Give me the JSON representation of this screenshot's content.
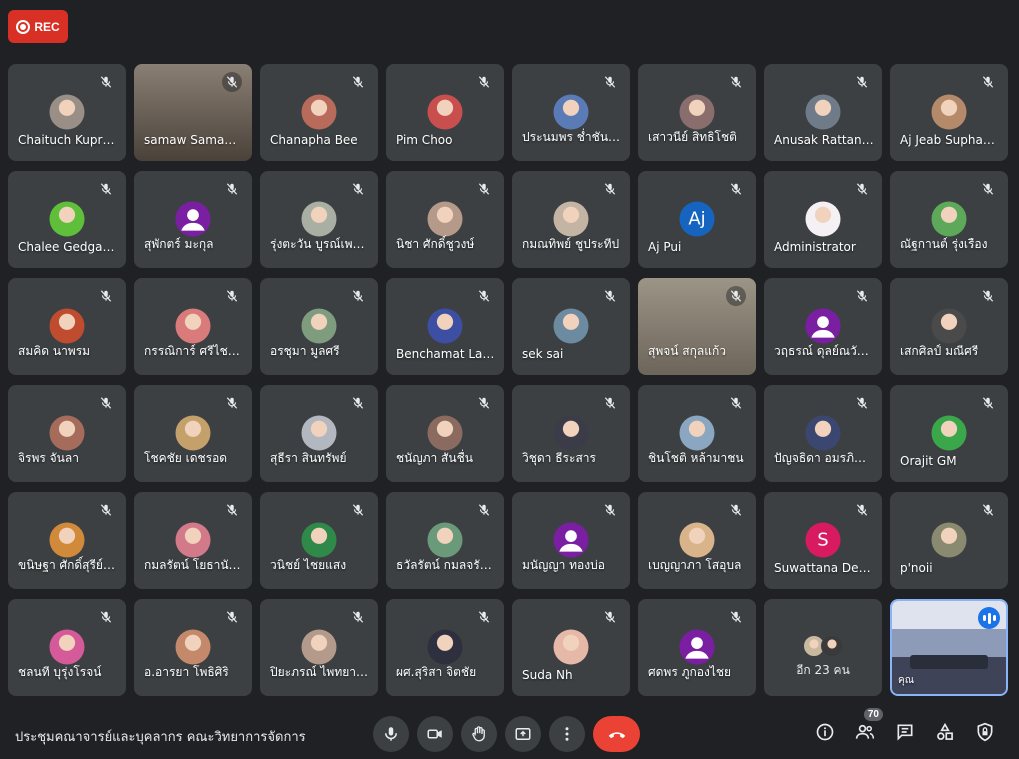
{
  "recording": {
    "label": "REC",
    "color": "#d93025"
  },
  "participants": [
    {
      "name": "Chaituch Kupra…",
      "type": "photo",
      "color": "#9a8f86"
    },
    {
      "name": "samaw Sama…",
      "type": "video"
    },
    {
      "name": "Chanapha Bee",
      "type": "photo",
      "color": "#b86b5a"
    },
    {
      "name": "Pim Choo",
      "type": "photo",
      "color": "#c94f4f"
    },
    {
      "name": "ประนมพร ช่ำชันม…",
      "type": "photo",
      "color": "#5a7bb5"
    },
    {
      "name": "เสาวนีย์ สิทธิโชติ",
      "type": "photo",
      "color": "#8a6d6d"
    },
    {
      "name": "Anusak Rattana…",
      "type": "photo",
      "color": "#6f7b89"
    },
    {
      "name": "Aj Jeab Suphan…",
      "type": "photo",
      "color": "#b58a6b"
    },
    {
      "name": "Chalee Gedgaew",
      "type": "photo",
      "color": "#5fbf3a"
    },
    {
      "name": "สุพักตร์ มะกุล",
      "type": "default"
    },
    {
      "name": "รุ่งตะวัน บูรณ์เพนา…",
      "type": "photo",
      "color": "#a9b0a3"
    },
    {
      "name": "นิชา ศักดิ์ชูวงษ์",
      "type": "photo",
      "color": "#b59a8a"
    },
    {
      "name": "กมณทิพย์ ชูประทีป",
      "type": "photo",
      "color": "#c3b4a4"
    },
    {
      "name": "Aj Pui",
      "type": "letter",
      "letter": "Aj",
      "color": "#1565c0"
    },
    {
      "name": "Administrator",
      "type": "photo",
      "color": "#f5f0f3"
    },
    {
      "name": "ณัฐกานต์ รุ่งเรือง",
      "type": "photo",
      "color": "#5ea85a"
    },
    {
      "name": "สมคิด นาพรม",
      "type": "photo",
      "color": "#c04c2f"
    },
    {
      "name": "กรรณิการ์ ศรีไชย…",
      "type": "photo",
      "color": "#d97b7b"
    },
    {
      "name": "อรชุมา มูลศรี",
      "type": "photo",
      "color": "#7f9c7f"
    },
    {
      "name": "Benchamat Lak…",
      "type": "photo",
      "color": "#3d4fa3"
    },
    {
      "name": "sek sai",
      "type": "photo",
      "color": "#6c8aa0"
    },
    {
      "name": "สุพจน์ สกุลแก้ว",
      "type": "video"
    },
    {
      "name": "วฤธรณ์ ดุลย์ณวัฒน์",
      "type": "default"
    },
    {
      "name": "เสกศิลป์ มณีศรี",
      "type": "photo",
      "color": "#4a4a4a"
    },
    {
      "name": "จิรพร จันลา",
      "type": "photo",
      "color": "#a56c5c"
    },
    {
      "name": "โชคชัย เดชรอด",
      "type": "photo",
      "color": "#c4a06a"
    },
    {
      "name": "สุธีรา สินทรัพย์",
      "type": "photo",
      "color": "#b3b8c0"
    },
    {
      "name": "ชนัญภา สันชื่น",
      "type": "photo",
      "color": "#8b6b5f"
    },
    {
      "name": "วิชุดา ธีระสาร",
      "type": "photo",
      "color": "#3c3c48"
    },
    {
      "name": "ชินโชติ หล้ามาชน",
      "type": "photo",
      "color": "#8aa6c0"
    },
    {
      "name": "ปัญจธิดา อมรภิญ…",
      "type": "photo",
      "color": "#3b4770"
    },
    {
      "name": "Orajit GM",
      "type": "photo",
      "color": "#3aa84a"
    },
    {
      "name": "ขนิษฐา ศักดิ์สุรีย์ม…",
      "type": "photo",
      "color": "#d08a3a"
    },
    {
      "name": "กมลรัตน์ โยธานันต์",
      "type": "photo",
      "color": "#d27a8a"
    },
    {
      "name": "วนิชย์ ไชยแสง",
      "type": "photo",
      "color": "#2f8a4a"
    },
    {
      "name": "ธวัลรัตน์ กมลจรัสเ…",
      "type": "photo",
      "color": "#6a9a7a"
    },
    {
      "name": "มนัญญา ทองบ่อ",
      "type": "default"
    },
    {
      "name": "เบญญาภา โสอุบล",
      "type": "photo",
      "color": "#d9b38a"
    },
    {
      "name": "Suwattana Dee…",
      "type": "letter",
      "letter": "S",
      "color": "#d81b60"
    },
    {
      "name": "p'noii",
      "type": "photo",
      "color": "#8a8a70"
    },
    {
      "name": "ชลนที บุรุ่งโรจน์",
      "type": "photo",
      "color": "#d45a9a"
    },
    {
      "name": "อ.อารยา โพธิศิริ",
      "type": "photo",
      "color": "#c4886b"
    },
    {
      "name": "ปิยะภรณ์ ไพทยา…",
      "type": "photo",
      "color": "#b49a8a"
    },
    {
      "name": "ผศ.สุริสา จิตชัย",
      "type": "photo",
      "color": "#2e3040"
    },
    {
      "name": "Suda Nh",
      "type": "photo",
      "color": "#e6b8a8"
    },
    {
      "name": "ศดพร ภูกองไชย",
      "type": "default"
    }
  ],
  "more_tile": {
    "label": "อีก 23 คน",
    "colors": [
      "#c9b8a0",
      "#3a3a3a"
    ]
  },
  "self_tile": {
    "name": "คุณ"
  },
  "meeting": {
    "title": "ประชุมคณาจารย์และบุคลากร คณะวิทยาการจัดการ"
  },
  "controls": {
    "mic_icon": "microphone-icon",
    "camera_icon": "camera-icon",
    "hand_icon": "raise-hand-icon",
    "present_icon": "present-screen-icon",
    "more_icon": "more-options-icon",
    "end_icon": "end-call-icon",
    "end_color": "#ea4335"
  },
  "right_controls": {
    "people_count": "70"
  }
}
